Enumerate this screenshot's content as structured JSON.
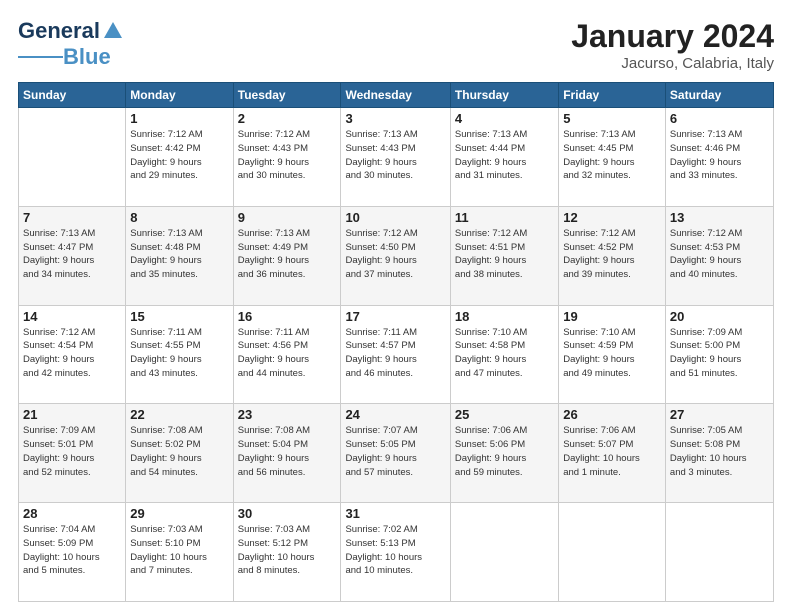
{
  "header": {
    "logo_general": "General",
    "logo_blue": "Blue",
    "title": "January 2024",
    "subtitle": "Jacurso, Calabria, Italy"
  },
  "weekdays": [
    "Sunday",
    "Monday",
    "Tuesday",
    "Wednesday",
    "Thursday",
    "Friday",
    "Saturday"
  ],
  "weeks": [
    [
      {
        "day": "",
        "sunrise": "",
        "sunset": "",
        "daylight": ""
      },
      {
        "day": "1",
        "sunrise": "Sunrise: 7:12 AM",
        "sunset": "Sunset: 4:42 PM",
        "daylight": "Daylight: 9 hours and 29 minutes."
      },
      {
        "day": "2",
        "sunrise": "Sunrise: 7:12 AM",
        "sunset": "Sunset: 4:43 PM",
        "daylight": "Daylight: 9 hours and 30 minutes."
      },
      {
        "day": "3",
        "sunrise": "Sunrise: 7:13 AM",
        "sunset": "Sunset: 4:43 PM",
        "daylight": "Daylight: 9 hours and 30 minutes."
      },
      {
        "day": "4",
        "sunrise": "Sunrise: 7:13 AM",
        "sunset": "Sunset: 4:44 PM",
        "daylight": "Daylight: 9 hours and 31 minutes."
      },
      {
        "day": "5",
        "sunrise": "Sunrise: 7:13 AM",
        "sunset": "Sunset: 4:45 PM",
        "daylight": "Daylight: 9 hours and 32 minutes."
      },
      {
        "day": "6",
        "sunrise": "Sunrise: 7:13 AM",
        "sunset": "Sunset: 4:46 PM",
        "daylight": "Daylight: 9 hours and 33 minutes."
      }
    ],
    [
      {
        "day": "7",
        "sunrise": "Sunrise: 7:13 AM",
        "sunset": "Sunset: 4:47 PM",
        "daylight": "Daylight: 9 hours and 34 minutes."
      },
      {
        "day": "8",
        "sunrise": "Sunrise: 7:13 AM",
        "sunset": "Sunset: 4:48 PM",
        "daylight": "Daylight: 9 hours and 35 minutes."
      },
      {
        "day": "9",
        "sunrise": "Sunrise: 7:13 AM",
        "sunset": "Sunset: 4:49 PM",
        "daylight": "Daylight: 9 hours and 36 minutes."
      },
      {
        "day": "10",
        "sunrise": "Sunrise: 7:12 AM",
        "sunset": "Sunset: 4:50 PM",
        "daylight": "Daylight: 9 hours and 37 minutes."
      },
      {
        "day": "11",
        "sunrise": "Sunrise: 7:12 AM",
        "sunset": "Sunset: 4:51 PM",
        "daylight": "Daylight: 9 hours and 38 minutes."
      },
      {
        "day": "12",
        "sunrise": "Sunrise: 7:12 AM",
        "sunset": "Sunset: 4:52 PM",
        "daylight": "Daylight: 9 hours and 39 minutes."
      },
      {
        "day": "13",
        "sunrise": "Sunrise: 7:12 AM",
        "sunset": "Sunset: 4:53 PM",
        "daylight": "Daylight: 9 hours and 40 minutes."
      }
    ],
    [
      {
        "day": "14",
        "sunrise": "Sunrise: 7:12 AM",
        "sunset": "Sunset: 4:54 PM",
        "daylight": "Daylight: 9 hours and 42 minutes."
      },
      {
        "day": "15",
        "sunrise": "Sunrise: 7:11 AM",
        "sunset": "Sunset: 4:55 PM",
        "daylight": "Daylight: 9 hours and 43 minutes."
      },
      {
        "day": "16",
        "sunrise": "Sunrise: 7:11 AM",
        "sunset": "Sunset: 4:56 PM",
        "daylight": "Daylight: 9 hours and 44 minutes."
      },
      {
        "day": "17",
        "sunrise": "Sunrise: 7:11 AM",
        "sunset": "Sunset: 4:57 PM",
        "daylight": "Daylight: 9 hours and 46 minutes."
      },
      {
        "day": "18",
        "sunrise": "Sunrise: 7:10 AM",
        "sunset": "Sunset: 4:58 PM",
        "daylight": "Daylight: 9 hours and 47 minutes."
      },
      {
        "day": "19",
        "sunrise": "Sunrise: 7:10 AM",
        "sunset": "Sunset: 4:59 PM",
        "daylight": "Daylight: 9 hours and 49 minutes."
      },
      {
        "day": "20",
        "sunrise": "Sunrise: 7:09 AM",
        "sunset": "Sunset: 5:00 PM",
        "daylight": "Daylight: 9 hours and 51 minutes."
      }
    ],
    [
      {
        "day": "21",
        "sunrise": "Sunrise: 7:09 AM",
        "sunset": "Sunset: 5:01 PM",
        "daylight": "Daylight: 9 hours and 52 minutes."
      },
      {
        "day": "22",
        "sunrise": "Sunrise: 7:08 AM",
        "sunset": "Sunset: 5:02 PM",
        "daylight": "Daylight: 9 hours and 54 minutes."
      },
      {
        "day": "23",
        "sunrise": "Sunrise: 7:08 AM",
        "sunset": "Sunset: 5:04 PM",
        "daylight": "Daylight: 9 hours and 56 minutes."
      },
      {
        "day": "24",
        "sunrise": "Sunrise: 7:07 AM",
        "sunset": "Sunset: 5:05 PM",
        "daylight": "Daylight: 9 hours and 57 minutes."
      },
      {
        "day": "25",
        "sunrise": "Sunrise: 7:06 AM",
        "sunset": "Sunset: 5:06 PM",
        "daylight": "Daylight: 9 hours and 59 minutes."
      },
      {
        "day": "26",
        "sunrise": "Sunrise: 7:06 AM",
        "sunset": "Sunset: 5:07 PM",
        "daylight": "Daylight: 10 hours and 1 minute."
      },
      {
        "day": "27",
        "sunrise": "Sunrise: 7:05 AM",
        "sunset": "Sunset: 5:08 PM",
        "daylight": "Daylight: 10 hours and 3 minutes."
      }
    ],
    [
      {
        "day": "28",
        "sunrise": "Sunrise: 7:04 AM",
        "sunset": "Sunset: 5:09 PM",
        "daylight": "Daylight: 10 hours and 5 minutes."
      },
      {
        "day": "29",
        "sunrise": "Sunrise: 7:03 AM",
        "sunset": "Sunset: 5:10 PM",
        "daylight": "Daylight: 10 hours and 7 minutes."
      },
      {
        "day": "30",
        "sunrise": "Sunrise: 7:03 AM",
        "sunset": "Sunset: 5:12 PM",
        "daylight": "Daylight: 10 hours and 8 minutes."
      },
      {
        "day": "31",
        "sunrise": "Sunrise: 7:02 AM",
        "sunset": "Sunset: 5:13 PM",
        "daylight": "Daylight: 10 hours and 10 minutes."
      },
      {
        "day": "",
        "sunrise": "",
        "sunset": "",
        "daylight": ""
      },
      {
        "day": "",
        "sunrise": "",
        "sunset": "",
        "daylight": ""
      },
      {
        "day": "",
        "sunrise": "",
        "sunset": "",
        "daylight": ""
      }
    ]
  ]
}
